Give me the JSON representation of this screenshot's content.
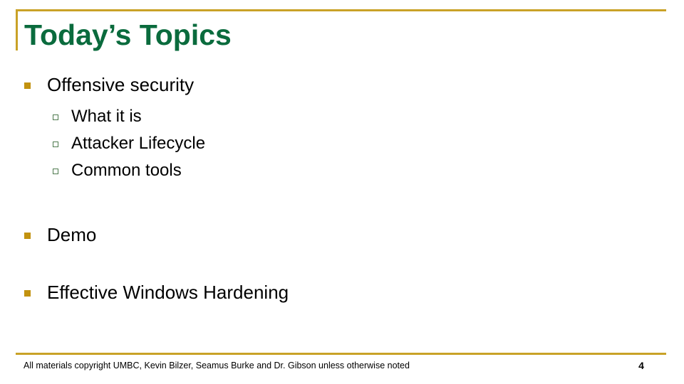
{
  "slide": {
    "title": "Today’s Topics",
    "page_number": "4",
    "footer": "All materials copyright UMBC, Kevin Bilzer, Seamus Burke and Dr. Gibson unless otherwise noted",
    "colors": {
      "title_green": "#0a6b3d",
      "accent_gold": "#c9a227",
      "bullet_gold": "#c2920f",
      "sub_bullet_green": "#4e7a4e",
      "text_black": "#000000",
      "background": "#ffffff"
    },
    "bullets": [
      {
        "label": "Offensive security",
        "bullet_icon": "filled-square-bullet-icon",
        "children": [
          {
            "label": "What it is",
            "bullet_icon": "hollow-square-bullet-icon"
          },
          {
            "label": "Attacker Lifecycle",
            "bullet_icon": "hollow-square-bullet-icon"
          },
          {
            "label": "Common tools",
            "bullet_icon": "hollow-square-bullet-icon"
          }
        ]
      },
      {
        "label": "Demo",
        "bullet_icon": "filled-square-bullet-icon",
        "children": []
      },
      {
        "label": "Effective Windows Hardening",
        "bullet_icon": "filled-square-bullet-icon",
        "children": []
      }
    ]
  }
}
